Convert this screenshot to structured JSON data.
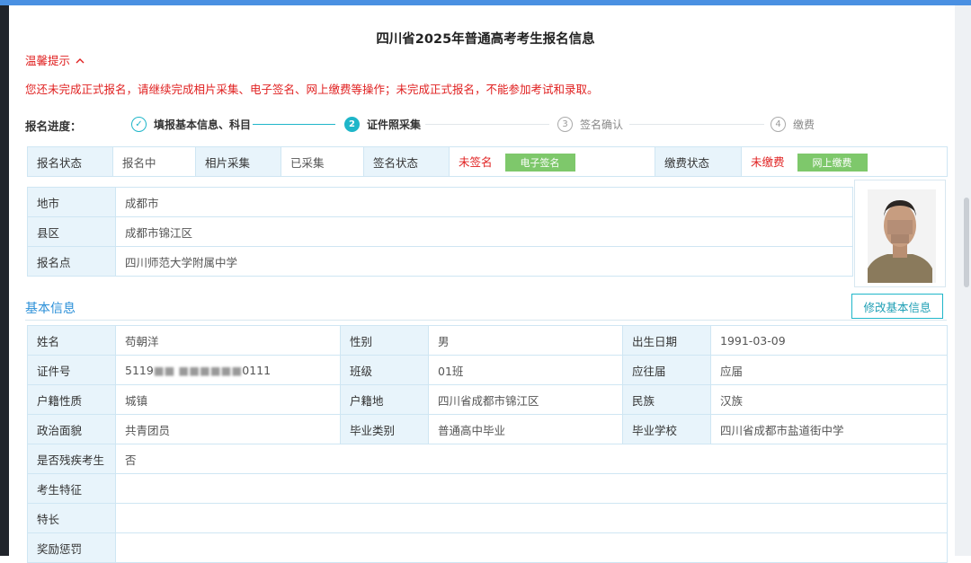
{
  "title": "四川省2025年普通高考考生报名信息",
  "warm_tip": "温馨提示",
  "warning": "您还未完成正式报名，请继续完成相片采集、电子签名、网上缴费等操作；未完成正式报名，不能参加考试和录取。",
  "progress": {
    "label": "报名进度：",
    "steps": [
      {
        "num": "✓",
        "label": "填报基本信息、科目"
      },
      {
        "num": "2",
        "label": "证件照采集"
      },
      {
        "num": "3",
        "label": "签名确认"
      },
      {
        "num": "4",
        "label": "缴费"
      }
    ]
  },
  "status": {
    "reg_label": "报名状态",
    "reg_value": "报名中",
    "photo_label": "相片采集",
    "photo_value": "已采集",
    "sign_label": "签名状态",
    "sign_value": "未签名",
    "sign_btn": "电子签名",
    "pay_label": "缴费状态",
    "pay_value": "未缴费",
    "pay_btn": "网上缴费"
  },
  "location": [
    {
      "label": "地市",
      "value": "成都市"
    },
    {
      "label": "县区",
      "value": "成都市锦江区"
    },
    {
      "label": "报名点",
      "value": "四川师范大学附属中学"
    }
  ],
  "basic": {
    "section_title": "基本信息",
    "edit_btn": "修改基本信息",
    "name_label": "姓名",
    "name": "苟朝洋",
    "gender_label": "性别",
    "gender": "男",
    "birth_label": "出生日期",
    "birth": "1991-03-09",
    "id_label": "证件号",
    "id_prefix": "5119",
    "id_masked": "■■ ■■■■■■",
    "id_suffix": "0111",
    "class_label": "班级",
    "class": "01班",
    "grad_type_label": "应往届",
    "grad_type": "应届",
    "hukou_type_label": "户籍性质",
    "hukou_type": "城镇",
    "hukou_label": "户籍地",
    "hukou": "四川省成都市锦江区",
    "ethnic_label": "民族",
    "ethnic": "汉族",
    "political_label": "政治面貌",
    "political": "共青团员",
    "grad_cat_label": "毕业类别",
    "grad_cat": "普通高中毕业",
    "school_label": "毕业学校",
    "school": "四川省成都市盐道街中学",
    "disabled_label": "是否残疾考生",
    "disabled": "否",
    "feature_label": "考生特征",
    "feature": "",
    "specialty_label": "特长",
    "specialty": "",
    "reward_label": "奖励惩罚",
    "reward": ""
  }
}
